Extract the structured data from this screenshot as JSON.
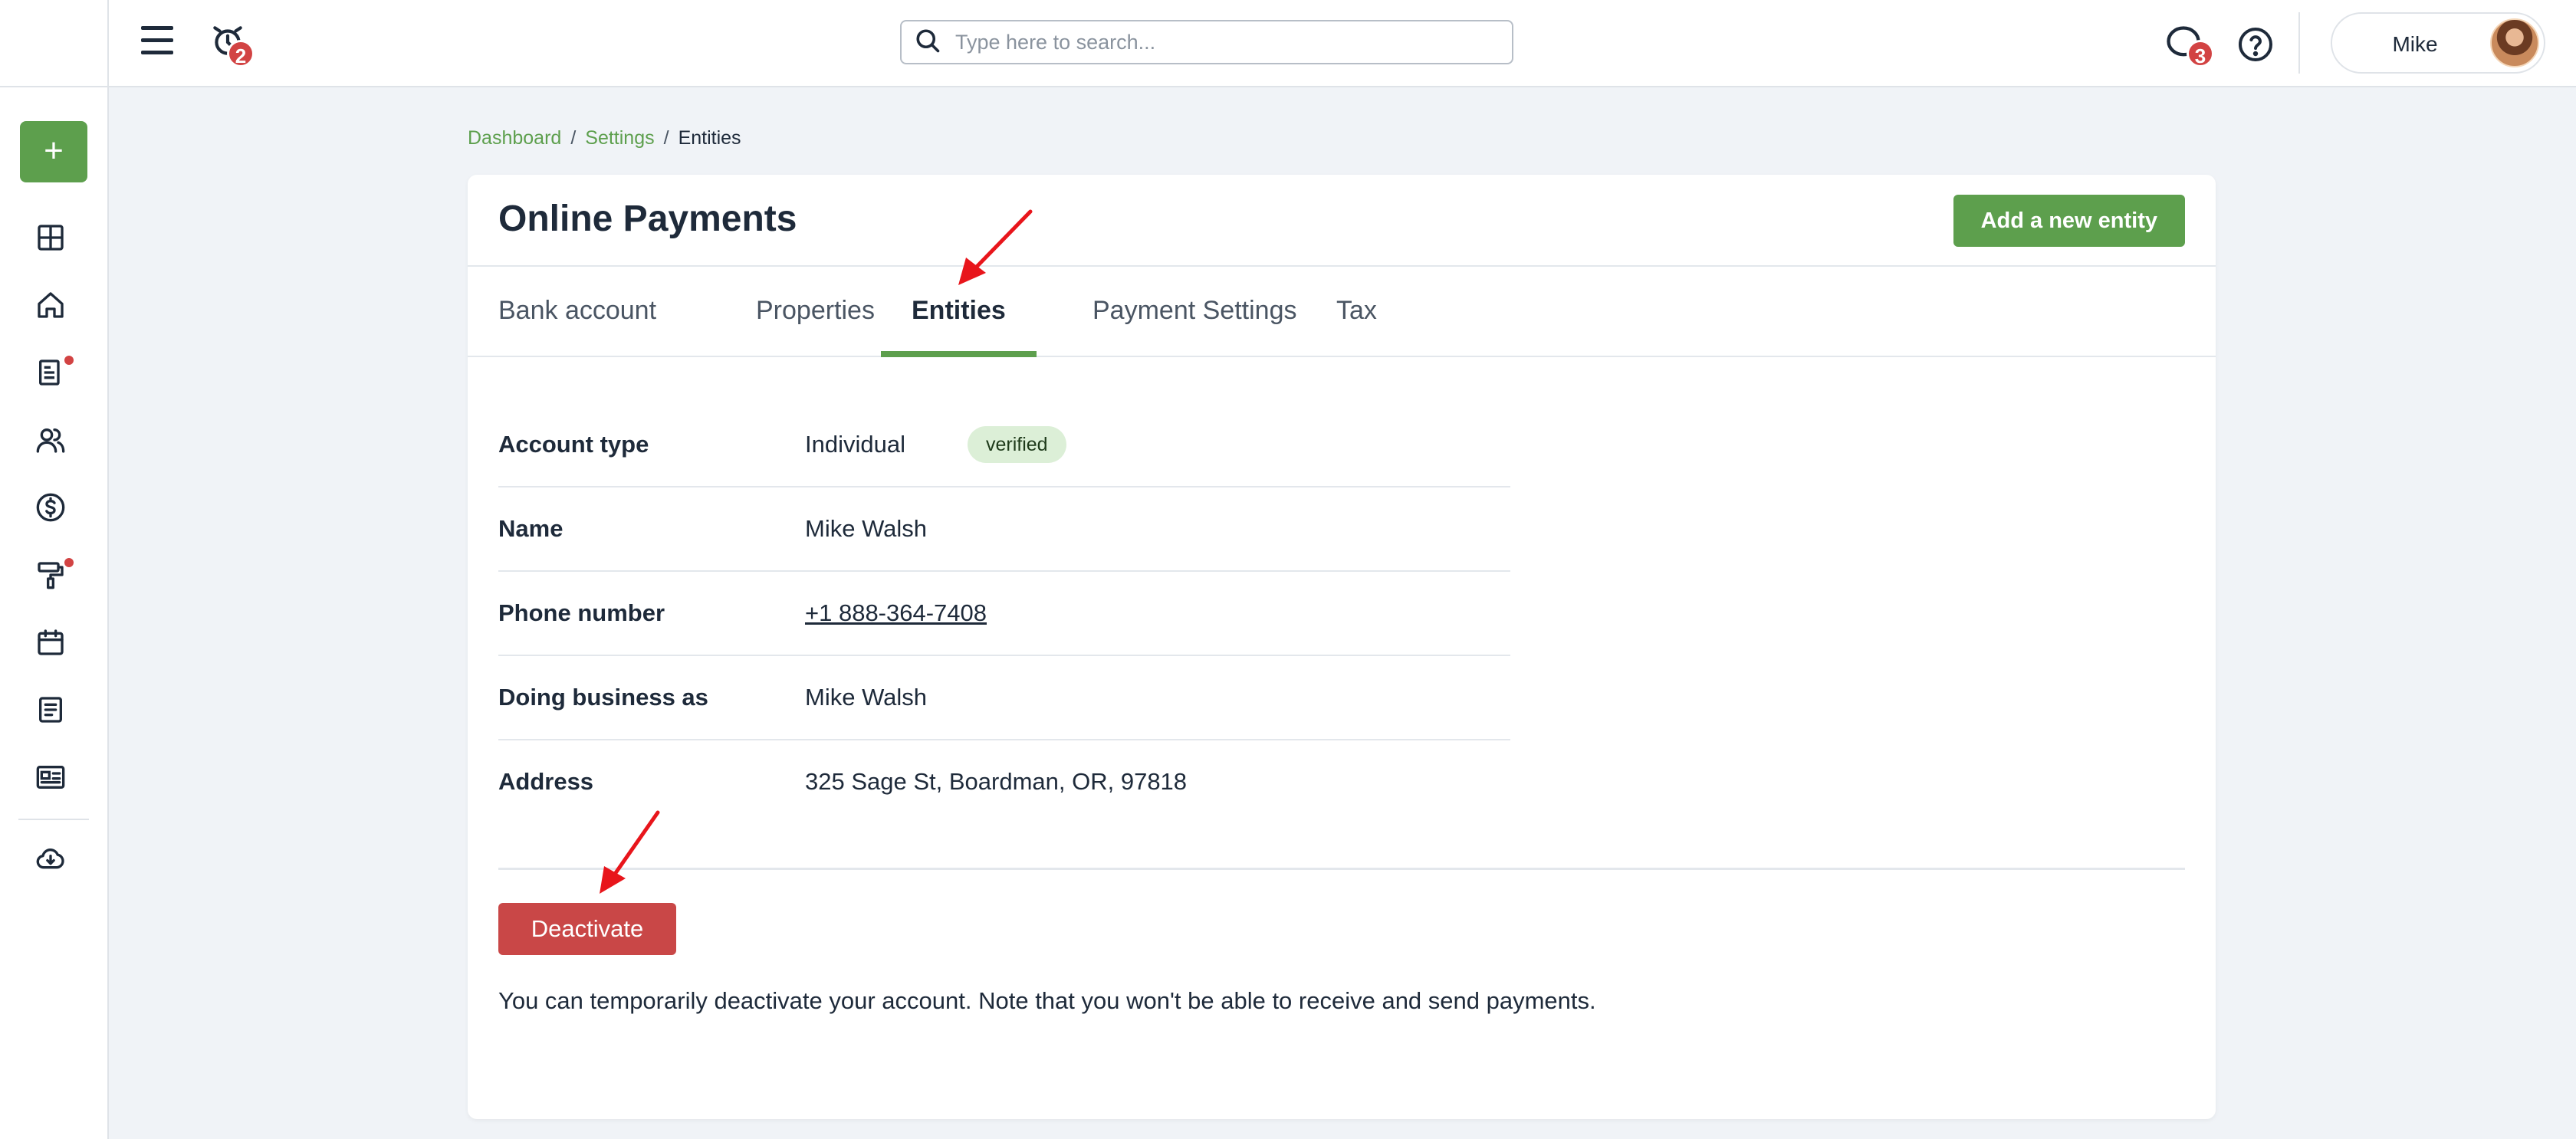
{
  "topbar": {
    "alarm_badge": "2",
    "search_placeholder": "Type here to search...",
    "chat_badge": "3",
    "user_name": "Mike"
  },
  "sidebar": {
    "add_label": "+",
    "items": [
      "dashboard-icon",
      "home-icon",
      "leases-icon",
      "people-icon",
      "money-icon",
      "maintenance-icon",
      "calendar-icon",
      "notes-icon",
      "reports-icon",
      "cloud-download-icon"
    ]
  },
  "breadcrumb": {
    "items": [
      "Dashboard",
      "Settings"
    ],
    "separator": "/",
    "current": "Entities"
  },
  "page": {
    "title": "Online Payments",
    "add_button": "Add a new entity",
    "tabs": [
      "Bank account",
      "Properties",
      "Entities",
      "Payment Settings",
      "Tax"
    ],
    "active_tab": "Entities"
  },
  "entity": {
    "rows": [
      {
        "label": "Account type",
        "value": "Individual",
        "badge": "verified"
      },
      {
        "label": "Name",
        "value": "Mike Walsh"
      },
      {
        "label": "Phone number",
        "value": "+1 888-364-7408"
      },
      {
        "label": "Doing business as",
        "value": "Mike Walsh"
      },
      {
        "label": "Address",
        "value": "325 Sage St, Boardman, OR, 97818"
      }
    ],
    "deactivate_label": "Deactivate",
    "note": "You can temporarily deactivate your account. Note that you won't be able to receive and send payments."
  },
  "colors": {
    "accent": "#5d9f4d",
    "danger": "#c94747",
    "badge": "#d24343",
    "annotation": "#e8151b"
  }
}
